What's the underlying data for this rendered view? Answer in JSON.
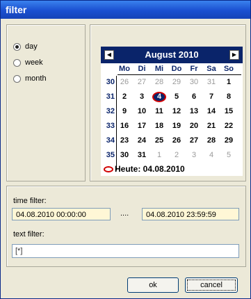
{
  "window": {
    "title": "filter"
  },
  "period": {
    "options": [
      {
        "label": "day",
        "checked": true
      },
      {
        "label": "week",
        "checked": false
      },
      {
        "label": "month",
        "checked": false
      }
    ]
  },
  "calendar": {
    "month_label": "August 2010",
    "prev_icon": "prev-month-icon",
    "next_icon": "next-month-icon",
    "weekdays": [
      "Mo",
      "Di",
      "Mi",
      "Do",
      "Fr",
      "Sa",
      "So"
    ],
    "weeks": [
      {
        "number": "30",
        "days": [
          {
            "d": "26",
            "o": true
          },
          {
            "d": "27",
            "o": true
          },
          {
            "d": "28",
            "o": true
          },
          {
            "d": "29",
            "o": true
          },
          {
            "d": "30",
            "o": true
          },
          {
            "d": "31",
            "o": true
          },
          {
            "d": "1",
            "o": false
          }
        ]
      },
      {
        "number": "31",
        "days": [
          {
            "d": "2",
            "o": false
          },
          {
            "d": "3",
            "o": false
          },
          {
            "d": "4",
            "o": false,
            "t": true
          },
          {
            "d": "5",
            "o": false
          },
          {
            "d": "6",
            "o": false
          },
          {
            "d": "7",
            "o": false
          },
          {
            "d": "8",
            "o": false
          }
        ]
      },
      {
        "number": "32",
        "days": [
          {
            "d": "9",
            "o": false
          },
          {
            "d": "10",
            "o": false
          },
          {
            "d": "11",
            "o": false
          },
          {
            "d": "12",
            "o": false
          },
          {
            "d": "13",
            "o": false
          },
          {
            "d": "14",
            "o": false
          },
          {
            "d": "15",
            "o": false
          }
        ]
      },
      {
        "number": "33",
        "days": [
          {
            "d": "16",
            "o": false
          },
          {
            "d": "17",
            "o": false
          },
          {
            "d": "18",
            "o": false
          },
          {
            "d": "19",
            "o": false
          },
          {
            "d": "20",
            "o": false
          },
          {
            "d": "21",
            "o": false
          },
          {
            "d": "22",
            "o": false
          }
        ]
      },
      {
        "number": "34",
        "days": [
          {
            "d": "23",
            "o": false
          },
          {
            "d": "24",
            "o": false
          },
          {
            "d": "25",
            "o": false
          },
          {
            "d": "26",
            "o": false
          },
          {
            "d": "27",
            "o": false
          },
          {
            "d": "28",
            "o": false
          },
          {
            "d": "29",
            "o": false
          }
        ]
      },
      {
        "number": "35",
        "days": [
          {
            "d": "30",
            "o": false
          },
          {
            "d": "31",
            "o": false
          },
          {
            "d": "1",
            "o": true
          },
          {
            "d": "2",
            "o": true
          },
          {
            "d": "3",
            "o": true
          },
          {
            "d": "4",
            "o": true
          },
          {
            "d": "5",
            "o": true
          }
        ]
      }
    ],
    "today_label": "Heute: 04.08.2010",
    "header_color": "#0a246a",
    "today_ring_color": "#d10000"
  },
  "time_filter": {
    "label": "time filter:",
    "from": "04.08.2010 00:00:00",
    "separator": "....",
    "to": "04.08.2010 23:59:59"
  },
  "text_filter": {
    "label": "text filter:",
    "value": "[*]"
  },
  "buttons": {
    "ok": "ok",
    "cancel": "cancel"
  }
}
